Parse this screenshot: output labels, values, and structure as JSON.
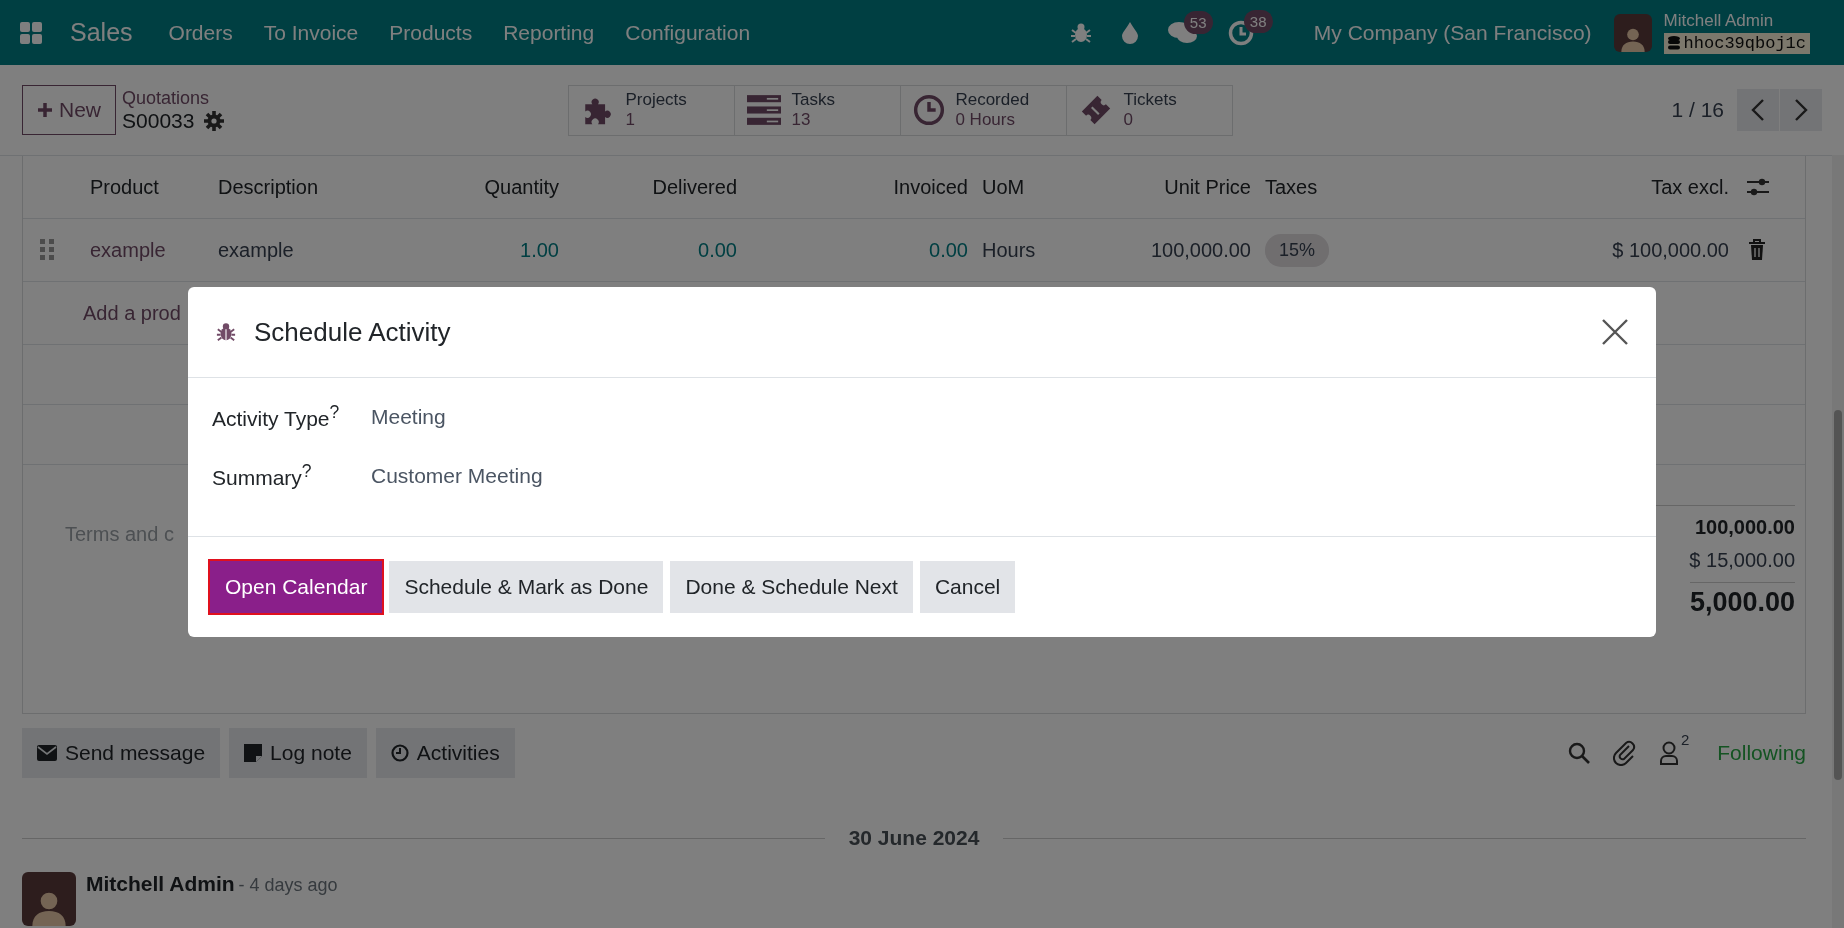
{
  "navbar": {
    "app_name": "Sales",
    "menu": [
      "Orders",
      "To Invoice",
      "Products",
      "Reporting",
      "Configuration"
    ],
    "messages_badge": "53",
    "activities_badge": "38",
    "company": "My Company (San Francisco)",
    "user": {
      "name": "Mitchell Admin",
      "database": "hhoc39qboj1c"
    }
  },
  "control_panel": {
    "new_button": "New",
    "breadcrumb": "Quotations",
    "record": "S00033",
    "stat_buttons": [
      {
        "kind": "projects",
        "label": "Projects",
        "value": "1"
      },
      {
        "kind": "tasks",
        "label": "Tasks",
        "value": "13"
      },
      {
        "kind": "recorded",
        "label": "Recorded",
        "value": "0 Hours"
      },
      {
        "kind": "tickets",
        "label": "Tickets",
        "value": "0"
      }
    ],
    "pager": "1 / 16"
  },
  "order_lines": {
    "columns": [
      "Product",
      "Description",
      "Quantity",
      "Delivered",
      "Invoiced",
      "UoM",
      "Unit Price",
      "Taxes",
      "Tax excl."
    ],
    "rows": [
      {
        "product": "example",
        "description": "example",
        "quantity": "1.00",
        "delivered": "0.00",
        "invoiced": "0.00",
        "uom": "Hours",
        "unit_price": "100,000.00",
        "taxes": "15%",
        "tax_excl": "$ 100,000.00"
      }
    ],
    "add_link": "Add a prod"
  },
  "terms_placeholder": "Terms and c",
  "totals": [
    {
      "kind": "untaxed",
      "value": "100,000.00"
    },
    {
      "kind": "tax",
      "value": "$ 15,000.00"
    },
    {
      "kind": "total",
      "value": "5,000.00"
    }
  ],
  "chatter": {
    "buttons": [
      {
        "kind": "message",
        "label": "Send message"
      },
      {
        "kind": "note",
        "label": "Log note"
      },
      {
        "kind": "activities",
        "label": "Activities"
      }
    ],
    "followers_count": "2",
    "follow_status": "Following",
    "date": "30 June 2024",
    "message": {
      "author": "Mitchell Admin",
      "time": "- 4 days ago"
    }
  },
  "dialog": {
    "title": "Schedule Activity",
    "fields": [
      {
        "label": "Activity Type",
        "hint": "?",
        "value": "Meeting"
      },
      {
        "label": "Summary",
        "hint": "?",
        "value": "Customer Meeting"
      }
    ],
    "buttons": [
      {
        "kind": "primary",
        "label": "Open Calendar"
      },
      {
        "kind": "secondary",
        "label": "Schedule & Mark as Done"
      },
      {
        "kind": "secondary",
        "label": "Done & Schedule Next"
      },
      {
        "kind": "secondary",
        "label": "Cancel"
      }
    ]
  }
}
